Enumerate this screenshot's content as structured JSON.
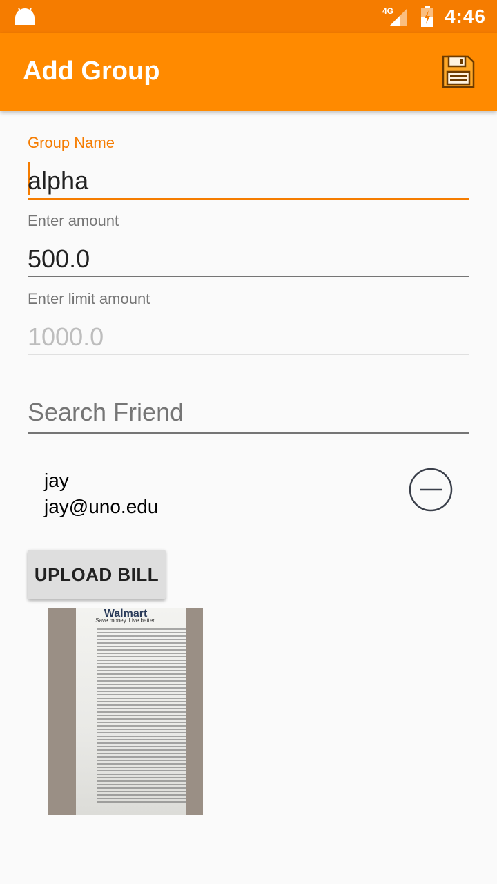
{
  "status_bar": {
    "network": "4G",
    "time": "4:46"
  },
  "app_bar": {
    "title": "Add Group",
    "save_icon": "floppy-disk-icon"
  },
  "form": {
    "group_name": {
      "label": "Group Name",
      "value": "alpha"
    },
    "amount": {
      "label": "Enter amount",
      "value": "500.0"
    },
    "limit_amount": {
      "label": "Enter limit amount",
      "placeholder": "1000.0"
    },
    "search": {
      "placeholder": "Search Friend"
    }
  },
  "friends": [
    {
      "name": "jay",
      "email": "jay@uno.edu",
      "action_icon": "remove-circle-icon"
    }
  ],
  "upload_button": {
    "label": "UPLOAD BILL"
  },
  "bill_image": {
    "brand": "Walmart",
    "tagline": "Save money. Live better."
  },
  "colors": {
    "status_bar": "#f57c00",
    "app_bar": "#ff8a00",
    "accent": "#f57c00"
  }
}
